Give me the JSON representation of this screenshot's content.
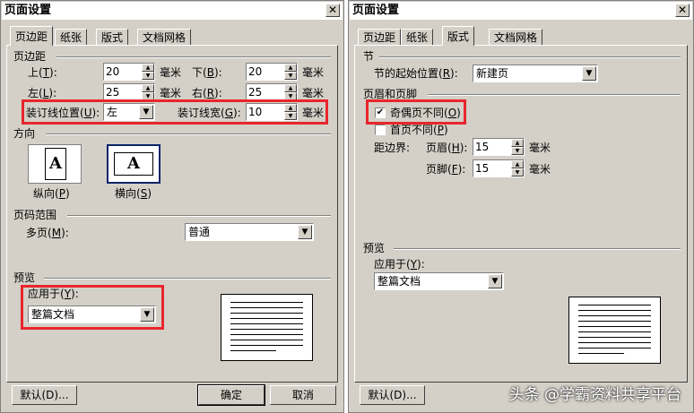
{
  "dialog1": {
    "title": "页面设置",
    "tabs": [
      "页边距",
      "纸张",
      "版式",
      "文档网格"
    ],
    "margins_group": "页边距",
    "top_label": "上",
    "top_key": "T",
    "top_value": "20",
    "bottom_label": "下",
    "bottom_key": "B",
    "bottom_value": "20",
    "left_label": "左",
    "left_key": "L",
    "left_value": "25",
    "right_label": "右",
    "right_key": "R",
    "right_value": "25",
    "unit": "毫米",
    "gutter_pos_label": "装订线位置",
    "gutter_pos_key": "U",
    "gutter_pos_value": "左",
    "gutter_label": "装订线宽",
    "gutter_key": "G",
    "gutter_value": "10",
    "orientation_group": "方向",
    "portrait_label": "纵向",
    "portrait_key": "P",
    "landscape_label": "横向",
    "landscape_key": "S",
    "pages_group": "页码范围",
    "multi_pages_label": "多页",
    "multi_pages_key": "M",
    "multi_pages_value": "普通",
    "preview_group": "预览",
    "apply_to_label": "应用于",
    "apply_to_key": "Y",
    "apply_to_value": "整篇文档",
    "default_button": "默认(D)...",
    "ok_button": "确定",
    "cancel_button": "取消"
  },
  "dialog2": {
    "title": "页面设置",
    "tabs": [
      "页边距",
      "纸张",
      "版式",
      "文档网格"
    ],
    "section_group": "节",
    "section_start_label": "节的起始位置",
    "section_start_key": "R",
    "section_start_value": "新建页",
    "header_footer_group": "页眉和页脚",
    "odd_even_label": "奇偶页不同",
    "odd_even_key": "O",
    "odd_even_checked": true,
    "first_page_label": "首页不同",
    "first_page_key": "P",
    "first_page_checked": false,
    "from_edge_label": "距边界:",
    "header_label": "页眉",
    "header_key": "H",
    "header_value": "15",
    "footer_label": "页脚",
    "footer_key": "F",
    "footer_value": "15",
    "unit": "毫米",
    "preview_group": "预览",
    "apply_to_label": "应用于",
    "apply_to_key": "Y",
    "apply_to_value": "整篇文档",
    "default_button": "默认(D)..."
  },
  "watermark": "头条 @学霸资料共享平台",
  "colors": {
    "dialog_bg": "#d4d0c8",
    "highlight": "#e8262c",
    "title_bg": "#ffffff"
  },
  "icons": {
    "close": "close-icon",
    "dropdown": "chevron-down-icon",
    "spin_up": "spin-up-icon",
    "spin_down": "spin-down-icon",
    "check": "checkmark-icon"
  }
}
